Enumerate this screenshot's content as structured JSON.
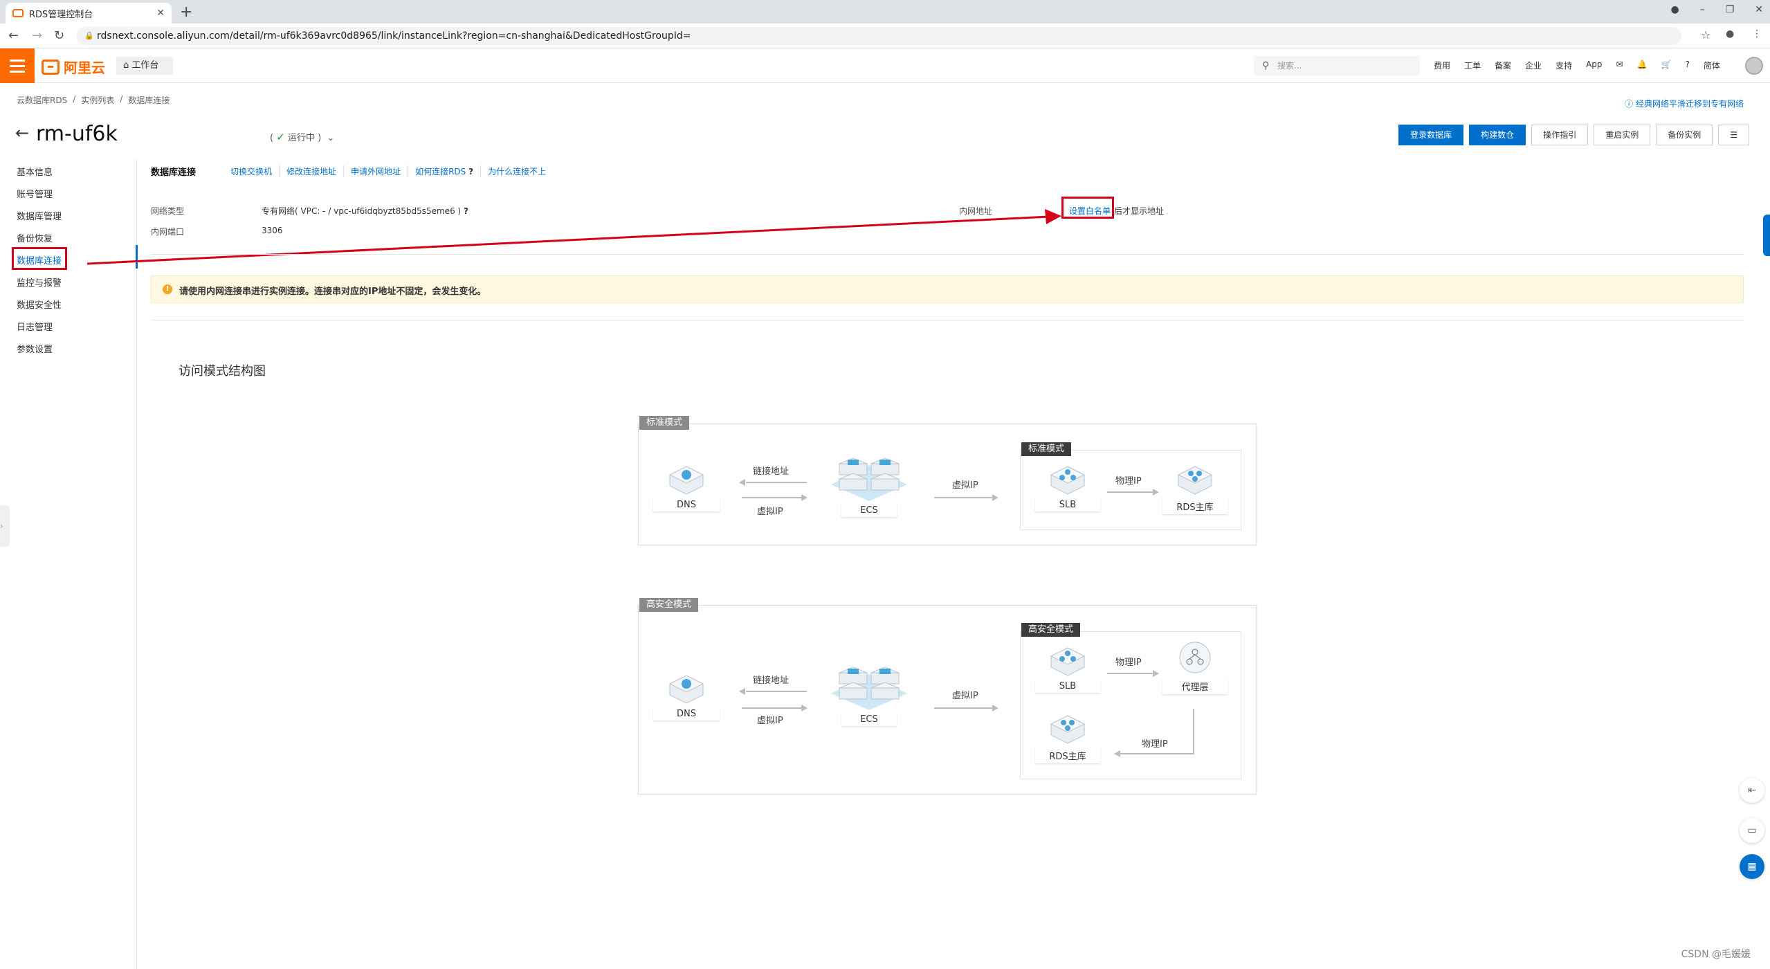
{
  "browser": {
    "tab_title": "RDS管理控制台",
    "url": "rdsnext.console.aliyun.com/detail/rm-uf6k369avrc0d8965/link/instanceLink?region=cn-shanghai&DedicatedHostGroupId="
  },
  "header": {
    "logo_text": "阿里云",
    "workbench": "工作台",
    "search_placeholder": "搜索...",
    "links": [
      "费用",
      "工单",
      "备案",
      "企业",
      "支持",
      "App"
    ],
    "lang": "简体"
  },
  "breadcrumb": [
    "云数据库RDS",
    "实例列表",
    "数据库连接"
  ],
  "classic_link": "经典网络平滑迁移到专有网络",
  "instance": {
    "name": "rm-uf6k",
    "status": "运行中"
  },
  "actions": [
    "登录数据库",
    "构建数仓",
    "操作指引",
    "重启实例",
    "备份实例"
  ],
  "menu": [
    "基本信息",
    "账号管理",
    "数据库管理",
    "备份恢复",
    "数据库连接",
    "监控与报警",
    "数据安全性",
    "日志管理",
    "参数设置"
  ],
  "conn": {
    "title": "数据库连接",
    "links": [
      "切换交换机",
      "修改连接地址",
      "申请外网地址",
      "如何连接RDS",
      "为什么连接不上"
    ],
    "network_type_label": "网络类型",
    "network_type_value": "专有网络( VPC: - / vpc-uf6idqbyzt85bd5s5eme6 )",
    "port_label": "内网端口",
    "port_value": "3306",
    "intranet_label": "内网地址",
    "whitelist_link": "设置白名单",
    "whitelist_rest": "后才显示地址"
  },
  "notice": "请使用内网连接串进行实例连接。连接串对应的IP地址不固定，会发生变化。",
  "diagram": {
    "title": "访问模式结构图",
    "standard": {
      "tag": "标准模式",
      "inner_tag": "标准模式",
      "dns": "DNS",
      "link_addr": "链接地址",
      "vip_back": "虚拟IP",
      "ecs": "ECS",
      "vip": "虚拟IP",
      "slb": "SLB",
      "phys_ip": "物理IP",
      "rds": "RDS主库"
    },
    "secure": {
      "tag": "高安全模式",
      "inner_tag": "高安全模式",
      "dns": "DNS",
      "link_addr": "链接地址",
      "vip_back": "虚拟IP",
      "ecs": "ECS",
      "vip": "虚拟IP",
      "slb": "SLB",
      "phys_ip": "物理IP",
      "proxy": "代理层",
      "rds": "RDS主库",
      "phys_ip2": "物理IP"
    }
  },
  "watermark": "CSDN @毛媛媛",
  "colors": {
    "accent": "#ff6a00",
    "primary": "#0070cc",
    "highlight": "#d4031b"
  }
}
